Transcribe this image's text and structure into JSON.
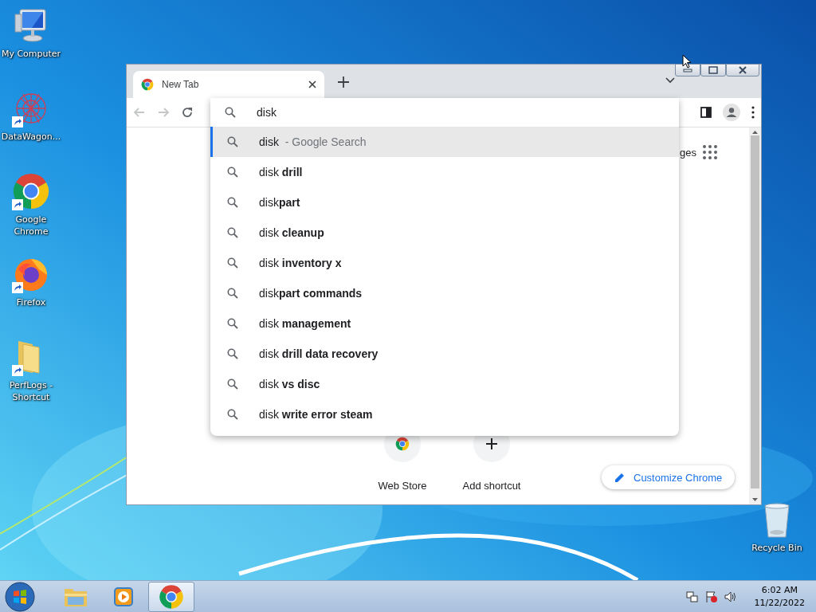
{
  "desktop_icons": [
    {
      "label": "My Computer",
      "kind": "computer",
      "shortcut": false
    },
    {
      "label": "DataWagon...",
      "kind": "web",
      "shortcut": true
    },
    {
      "label": "Google Chrome",
      "kind": "chrome",
      "shortcut": true
    },
    {
      "label": "Firefox",
      "kind": "firefox",
      "shortcut": true
    },
    {
      "label": "PerfLogs - Shortcut",
      "kind": "folder",
      "shortcut": true
    }
  ],
  "recycle_bin": {
    "label": "Recycle Bin"
  },
  "browser": {
    "tabs": [
      {
        "title": "New Tab",
        "selected": true
      }
    ],
    "nav": {
      "back_disabled": true,
      "forward_disabled": true
    },
    "omnibox": {
      "value": "disk"
    },
    "suggestions": [
      {
        "text": "disk",
        "hint": "- Google Search",
        "selected": true
      },
      {
        "text": "disk **drill**",
        "selected": false
      },
      {
        "text": "disk**part**",
        "selected": false
      },
      {
        "text": "disk **cleanup**",
        "selected": false
      },
      {
        "text": "disk **inventory x**",
        "selected": false
      },
      {
        "text": "disk**part commands**",
        "selected": false
      },
      {
        "text": "disk **management**",
        "selected": false
      },
      {
        "text": "disk **drill data recovery**",
        "selected": false
      },
      {
        "text": "disk **vs disc**",
        "selected": false
      },
      {
        "text": "disk **write error steam**",
        "selected": false
      }
    ],
    "header_link": "ges",
    "shortcuts": [
      {
        "label": "Web Store",
        "kind": "webstore"
      },
      {
        "label": "Add shortcut",
        "kind": "add"
      }
    ],
    "customize_button": "Customize Chrome"
  },
  "taskbar": {
    "apps": [
      {
        "kind": "explorer",
        "selected": false
      },
      {
        "kind": "media",
        "selected": false
      },
      {
        "kind": "chrome",
        "selected": true
      }
    ],
    "clock": {
      "time": "6:02 AM",
      "date": "11/22/2022"
    }
  }
}
